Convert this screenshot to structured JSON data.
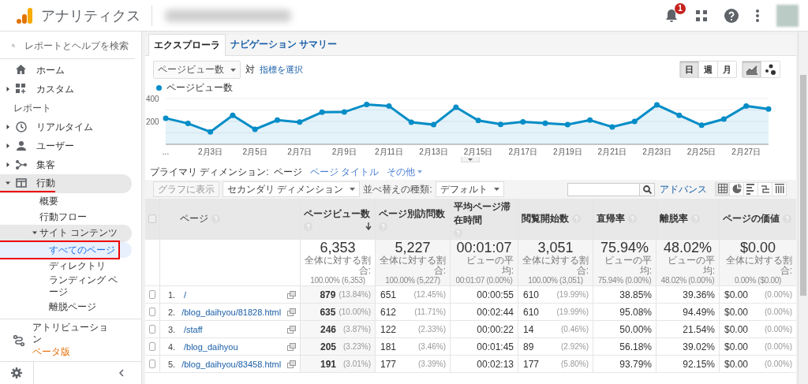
{
  "topbar": {
    "product": "アナリティクス",
    "notification_count": "1"
  },
  "sidebar": {
    "search": {
      "placeholder": "レポートとヘルプを検索"
    },
    "items": [
      {
        "label": "ホーム",
        "expandable": false,
        "expanded": false
      },
      {
        "label": "カスタム",
        "expandable": true,
        "expanded": false
      }
    ],
    "section_label": "レポート",
    "reports": [
      {
        "label": "リアルタイム",
        "expandable": true,
        "expanded": false,
        "selected": false,
        "underlined": false,
        "boxed": false
      },
      {
        "label": "ユーザー",
        "expandable": true,
        "expanded": false,
        "selected": false,
        "underlined": false,
        "boxed": false
      },
      {
        "label": "集客",
        "expandable": true,
        "expanded": false,
        "selected": false,
        "underlined": false,
        "boxed": false
      },
      {
        "label": "行動",
        "expandable": true,
        "expanded": true,
        "selected": false,
        "underlined": true,
        "boxed": false,
        "children": [
          {
            "label": "概要",
            "expandable": false,
            "expanded": false,
            "selected": false,
            "underlined": false,
            "boxed": false
          },
          {
            "label": "行動フロー",
            "expandable": false,
            "expanded": false,
            "selected": false,
            "underlined": false,
            "boxed": false
          },
          {
            "label": "サイト コンテンツ",
            "expandable": true,
            "expanded": true,
            "selected": false,
            "underlined": true,
            "boxed": false,
            "children": [
              {
                "label": "すべてのページ",
                "expandable": false,
                "expanded": false,
                "selected": true,
                "underlined": false,
                "boxed": true
              },
              {
                "label": "ディレクトリ",
                "expandable": false,
                "expanded": false,
                "selected": false,
                "underlined": false,
                "boxed": false
              },
              {
                "label": "ランディング ページ",
                "expandable": false,
                "expanded": false,
                "selected": false,
                "underlined": false,
                "boxed": false
              },
              {
                "label": "離脱ページ",
                "expandable": false,
                "expanded": false,
                "selected": false,
                "underlined": false,
                "boxed": false
              }
            ]
          }
        ]
      }
    ],
    "attribution": {
      "label": "アトリビューション",
      "badge": "ベータ版"
    }
  },
  "report_tabs": [
    {
      "label": "エクスプローラ",
      "selected": true
    },
    {
      "label": "ナビゲーション サマリー",
      "selected": false
    }
  ],
  "metric_controls": {
    "metric": "ページビュー数",
    "versus": "対",
    "select_metric": "指標を選択"
  },
  "interval_buttons": [
    {
      "label": "日",
      "selected": true
    },
    {
      "label": "週",
      "selected": false
    },
    {
      "label": "月",
      "selected": false
    }
  ],
  "chart_type_buttons": [
    {
      "selected": true
    },
    {
      "selected": false
    }
  ],
  "chart_data": {
    "type": "area",
    "categories": [
      "...",
      null,
      "2月3日",
      null,
      "2月5日",
      null,
      "2月7日",
      null,
      "2月9日",
      null,
      "2月11日",
      null,
      "2月13日",
      null,
      "2月15日",
      null,
      "2月17日",
      null,
      "2月19日",
      null,
      "2月21日",
      null,
      "2月23日",
      null,
      "2月25日",
      null,
      "2月27日",
      null
    ],
    "series": [
      {
        "name": "ページビュー数",
        "color": "#058dc7",
        "values": [
          228,
          182,
          109,
          254,
          131,
          212,
          194,
          281,
          282,
          349,
          335,
          193,
          172,
          324,
          209,
          175,
          197,
          184,
          173,
          212,
          152,
          200,
          344,
          254,
          167,
          221,
          335,
          309
        ]
      }
    ],
    "ylim": [
      0,
      400
    ],
    "yticks": [
      200,
      400
    ]
  },
  "dimensions": {
    "label": "プライマリ ディメンション:",
    "options": [
      {
        "label": "ページ",
        "selected": true,
        "kind": "option"
      },
      {
        "label": "ページ タイトル",
        "selected": false,
        "kind": "option"
      },
      {
        "label": "その他",
        "selected": false,
        "kind": "menu"
      }
    ]
  },
  "table_toolbar": {
    "plot_button": {
      "label": "グラフに表示",
      "disabled": true
    },
    "secondary_dimension": "セカンダリ ディメンション",
    "sort_label": "並べ替えの種類:",
    "sort_value": "デフォルト",
    "advanced": "アドバンス",
    "views": [
      {
        "selected": true
      },
      {
        "selected": false
      },
      {
        "selected": false
      },
      {
        "selected": false
      },
      {
        "selected": false
      }
    ]
  },
  "table": {
    "select_all": {
      "checked": false
    },
    "columns": [
      {
        "label": "ページ",
        "sorted": false
      },
      {
        "label": "ページビュー数",
        "sorted": true
      },
      {
        "label": "ページ別訪問数",
        "sorted": false
      },
      {
        "label": "平均ページ滞在時間",
        "sorted": false
      },
      {
        "label": "閲覧開始数",
        "sorted": false
      },
      {
        "label": "直帰率",
        "sorted": false
      },
      {
        "label": "離脱率",
        "sorted": false
      },
      {
        "label": "ページの価値",
        "sorted": false
      }
    ],
    "totals": [
      {
        "value": "6,353",
        "caption": "全体に対する割合:",
        "detail": "100.00% (6,353)"
      },
      {
        "value": "5,227",
        "caption": "全体に対する割合:",
        "detail": "100.00% (5,227)"
      },
      {
        "value": "00:01:07",
        "caption": "ビューの平均:",
        "detail": "00:01:07 (0.00%)"
      },
      {
        "value": "3,051",
        "caption": "全体に対する割合:",
        "detail": "100.00% (3,051)"
      },
      {
        "value": "75.94%",
        "caption": "ビューの平均:",
        "detail": "75.94% (0.00%)"
      },
      {
        "value": "48.02%",
        "caption": "ビューの平均:",
        "detail": "48.02% (0.00%)"
      },
      {
        "value": "$0.00",
        "caption": "全体に対する割合:",
        "detail": "0.00% ($0.00)"
      }
    ],
    "rows": [
      {
        "checked": false,
        "cells": [
          {
            "index": "1.",
            "value": "/"
          },
          {
            "value": "879",
            "share": "(13.84%)"
          },
          {
            "value": "651",
            "share": "(12.45%)"
          },
          {
            "value": "00:00:55"
          },
          {
            "value": "610",
            "share": "(19.99%)"
          },
          {
            "value": "38.85%"
          },
          {
            "value": "39.36%"
          },
          {
            "value": "$0.00",
            "share": "(0.00%)"
          }
        ]
      },
      {
        "checked": false,
        "cells": [
          {
            "index": "2.",
            "value": "/blog_daihyou/81828.html"
          },
          {
            "value": "635",
            "share": "(10.00%)"
          },
          {
            "value": "612",
            "share": "(11.71%)"
          },
          {
            "value": "00:02:44"
          },
          {
            "value": "610",
            "share": "(19.99%)"
          },
          {
            "value": "95.08%"
          },
          {
            "value": "94.49%"
          },
          {
            "value": "$0.00",
            "share": "(0.00%)"
          }
        ]
      },
      {
        "checked": false,
        "cells": [
          {
            "index": "3.",
            "value": "/staff"
          },
          {
            "value": "246",
            "share": "(3.87%)"
          },
          {
            "value": "122",
            "share": "(2.33%)"
          },
          {
            "value": "00:00:22"
          },
          {
            "value": "14",
            "share": "(0.46%)"
          },
          {
            "value": "50.00%"
          },
          {
            "value": "21.54%"
          },
          {
            "value": "$0.00",
            "share": "(0.00%)"
          }
        ]
      },
      {
        "checked": false,
        "cells": [
          {
            "index": "4.",
            "value": "/blog_daihyou"
          },
          {
            "value": "205",
            "share": "(3.23%)"
          },
          {
            "value": "181",
            "share": "(3.46%)"
          },
          {
            "value": "00:01:45"
          },
          {
            "value": "89",
            "share": "(2.92%)"
          },
          {
            "value": "56.18%"
          },
          {
            "value": "39.02%"
          },
          {
            "value": "$0.00",
            "share": "(0.00%)"
          }
        ]
      },
      {
        "checked": false,
        "cells": [
          {
            "index": "5.",
            "value": "/blog_daihyou/83458.html"
          },
          {
            "value": "191",
            "share": "(3.01%)"
          },
          {
            "value": "177",
            "share": "(3.39%)"
          },
          {
            "value": "00:02:13"
          },
          {
            "value": "177",
            "share": "(5.80%)"
          },
          {
            "value": "93.79%"
          },
          {
            "value": "92.15%"
          },
          {
            "value": "$0.00",
            "share": "(0.00%)"
          }
        ]
      }
    ]
  }
}
